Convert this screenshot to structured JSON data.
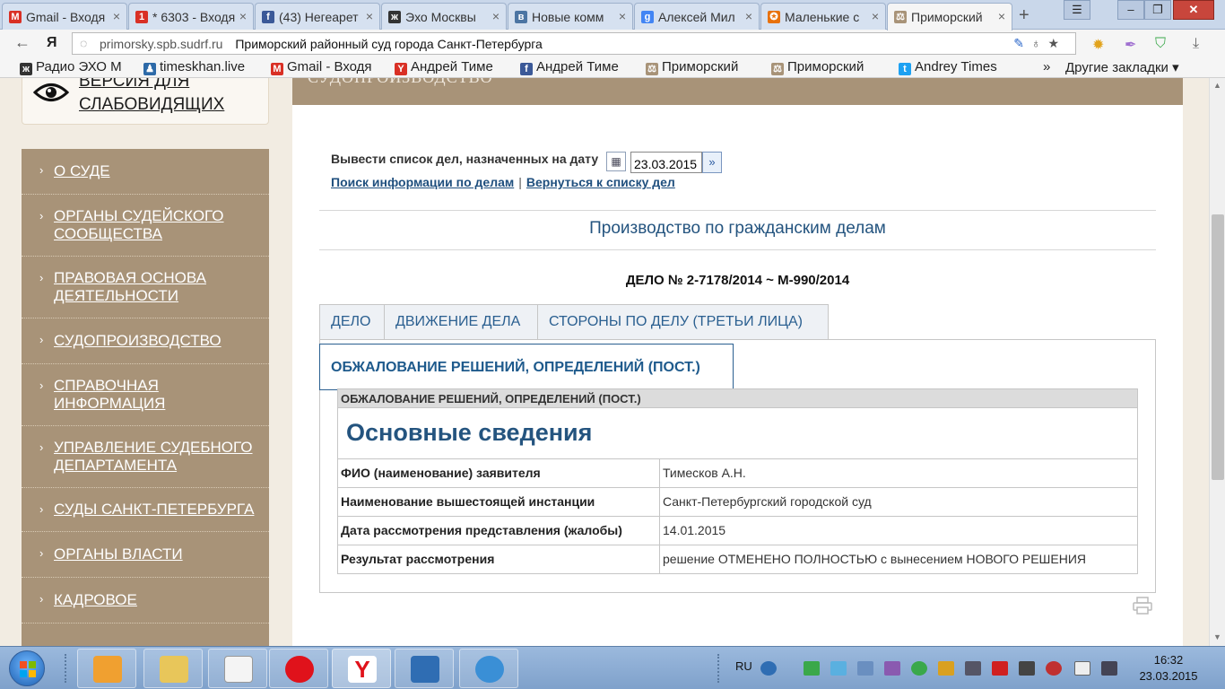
{
  "browser": {
    "tabs": [
      {
        "label": "Gmail - Входя",
        "icon": "gmail-icon",
        "color": "#d93025",
        "glyph": "M"
      },
      {
        "label": "* 6303 - Входя",
        "icon": "mail-icon",
        "color": "#d93025",
        "glyph": "1"
      },
      {
        "label": "(43) Негеарет",
        "icon": "facebook-icon",
        "color": "#3b5998",
        "glyph": "f"
      },
      {
        "label": "Эхо Москвы",
        "icon": "echo-icon",
        "color": "#333333",
        "glyph": "ж"
      },
      {
        "label": "Новые комм",
        "icon": "vk-icon",
        "color": "#4c75a3",
        "glyph": "в"
      },
      {
        "label": "Алексей Мил",
        "icon": "google-icon",
        "color": "#4285f4",
        "glyph": "g"
      },
      {
        "label": "Маленькие с",
        "icon": "blog-icon",
        "color": "#e8710a",
        "glyph": "✪"
      },
      {
        "label": "Приморский",
        "icon": "scales-icon",
        "color": "#a89378",
        "glyph": "⚖"
      }
    ],
    "url": "primorsky.spb.sudrf.ru",
    "page_title": "Приморский районный суд города Санкт-Петербурга",
    "bookmarks": [
      {
        "label": "Радио ЭХО М",
        "color": "#333333",
        "glyph": "ж"
      },
      {
        "label": "timeskhan.live",
        "color": "#2d6aa8",
        "glyph": "♟"
      },
      {
        "label": "Gmail - Входя",
        "color": "#d93025",
        "glyph": "M"
      },
      {
        "label": "Андрей Тиме",
        "color": "#d93025",
        "glyph": "Y"
      },
      {
        "label": "Андрей Тиме",
        "color": "#3b5998",
        "glyph": "f"
      },
      {
        "label": "Приморский",
        "color": "#a89378",
        "glyph": "⚖"
      },
      {
        "label": "Приморский",
        "color": "#a89378",
        "glyph": "⚖"
      },
      {
        "label": "Andrey Times",
        "color": "#1da1f2",
        "glyph": "t"
      }
    ],
    "more_bookmarks_label": "»",
    "other_bookmarks_label": "Другие закладки ▾"
  },
  "sidebar": {
    "vision_label": "ВЕРСИЯ ДЛЯ СЛАБОВИДЯЩИХ",
    "items": [
      {
        "label": "О СУДЕ"
      },
      {
        "label": "ОРГАНЫ СУДЕЙСКОГО СООБЩЕСТВА"
      },
      {
        "label": "ПРАВОВАЯ ОСНОВА ДЕЯТЕЛЬНОСТИ"
      },
      {
        "label": "СУДОПРОИЗВОДСТВО"
      },
      {
        "label": "СПРАВОЧНАЯ ИНФОРМАЦИЯ"
      },
      {
        "label": "УПРАВЛЕНИЕ СУДЕБНОГО ДЕПАРТАМЕНТА"
      },
      {
        "label": "СУДЫ САНКТ-ПЕТЕРБУРГА"
      },
      {
        "label": "ОРГАНЫ ВЛАСТИ"
      },
      {
        "label": "КАДРОВОЕ"
      }
    ]
  },
  "main": {
    "header": "СУДОПРОИЗВОДСТВО",
    "date_prompt": "Вывести список дел, назначенных на дату",
    "date_value": "23.03.2015",
    "link_search": "Поиск информации по делам",
    "link_sep": "|",
    "link_back": "Вернуться к списку дел",
    "section_title": "Производство по гражданским делам",
    "case_number": "ДЕЛО № 2-7178/2014 ~ М-990/2014",
    "tabs": [
      {
        "label": "ДЕЛО"
      },
      {
        "label": "ДВИЖЕНИЕ ДЕЛА"
      },
      {
        "label": "СТОРОНЫ ПО ДЕЛУ (ТРЕТЬИ ЛИЦА)"
      },
      {
        "label": "ОБЖАЛОВАНИЕ РЕШЕНИЙ, ОПРЕДЕЛЕНИЙ (ПОСТ.)"
      }
    ],
    "table_header": "ОБЖАЛОВАНИЕ РЕШЕНИЙ, ОПРЕДЕЛЕНИЙ (ПОСТ.)",
    "table_title": "Основные сведения",
    "rows": [
      {
        "key": "ФИО (наименование) заявителя",
        "value": "Тимесков А.Н."
      },
      {
        "key": "Наименование вышестоящей инстанции",
        "value": "Санкт-Петербургский городской суд"
      },
      {
        "key": "Дата рассмотрения представления (жалобы)",
        "value": "14.01.2015"
      },
      {
        "key": "Результат рассмотрения",
        "value": "решение ОТМЕНЕНО ПОЛНОСТЬЮ с вынесением НОВОГО РЕШЕНИЯ"
      }
    ]
  },
  "taskbar": {
    "language": "RU",
    "time": "16:32",
    "date": "23.03.2015"
  }
}
